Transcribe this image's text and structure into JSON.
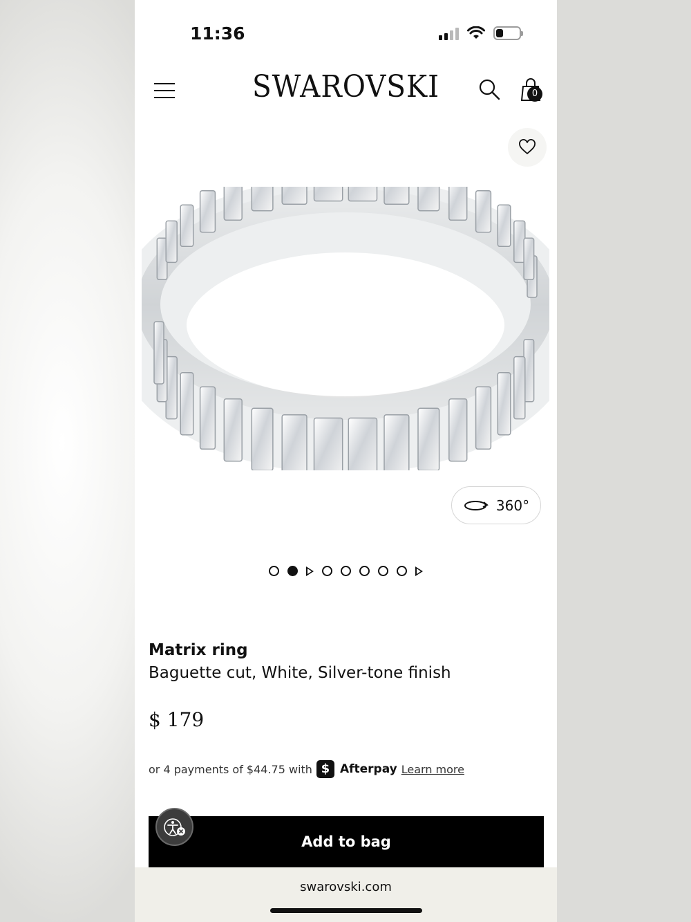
{
  "status_bar": {
    "time": "11:36"
  },
  "header": {
    "brand": "SWAROVSKI",
    "bag_count": "0"
  },
  "media": {
    "view_360_label": "360°"
  },
  "product": {
    "name": "Matrix ring",
    "subtitle": "Baguette cut, White, Silver-tone finish",
    "price": "$ 179"
  },
  "afterpay": {
    "text": "or 4 payments of $44.75 with",
    "logo_glyph": "$",
    "brand": "Afterpay",
    "learn_more": "Learn more"
  },
  "actions": {
    "add_to_bag": "Add to bag"
  },
  "browser": {
    "url": "swarovski.com"
  }
}
